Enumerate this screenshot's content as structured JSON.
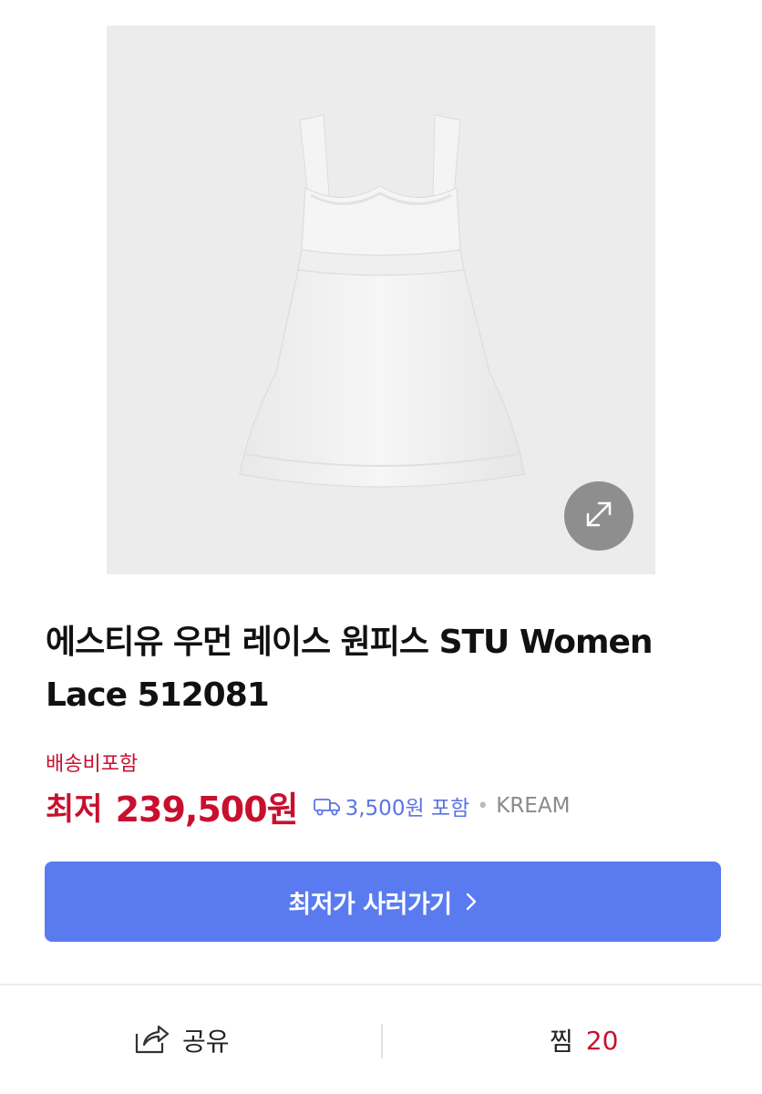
{
  "product": {
    "image_alt": "white lace mini dress",
    "title": "에스티유 우먼 레이스 원피스 STU Women Lace 512081"
  },
  "zoom": {
    "icon": "expand-arrows-icon"
  },
  "pricing": {
    "shipping_note": "배송비포함",
    "price_prefix": "최저",
    "price_value": "239,500원",
    "shipping_fee": "3,500원 포함",
    "separator": "•",
    "seller": "KREAM"
  },
  "cta": {
    "label": "최저가 사러가기"
  },
  "actions": {
    "share_label": "공유",
    "like_label": "찜",
    "like_count": "20"
  },
  "colors": {
    "accent_red": "#c8102e",
    "button_blue": "#5a7bf0",
    "link_blue": "#5b74e4",
    "image_bg": "#ececec"
  }
}
